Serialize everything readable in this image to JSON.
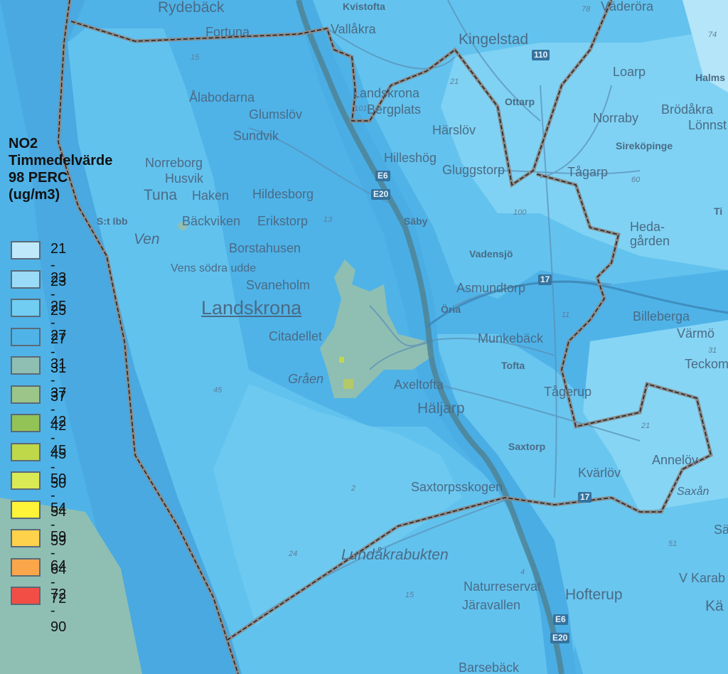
{
  "legend": {
    "title": [
      "NO2",
      "Timmedelvärde",
      "98 PERC",
      "(ug/m3)"
    ],
    "items": [
      {
        "label": "21 - 23",
        "color": "#bfe9fb"
      },
      {
        "label": "23 - 25",
        "color": "#9adcf7"
      },
      {
        "label": "25 - 27",
        "color": "#71cdf2"
      },
      {
        "label": "27 - 31",
        "color": "#4fb3e8"
      },
      {
        "label": "31 - 37",
        "color": "#8fbfb3"
      },
      {
        "label": "37 - 42",
        "color": "#9cc58a"
      },
      {
        "label": "42 - 45",
        "color": "#93c356"
      },
      {
        "label": "45 - 50",
        "color": "#bfd84a"
      },
      {
        "label": "50 - 54",
        "color": "#d9ea55"
      },
      {
        "label": "54 - 59",
        "color": "#fff438"
      },
      {
        "label": "59 - 64",
        "color": "#ffd24b"
      },
      {
        "label": "64 - 72",
        "color": "#fba64a"
      },
      {
        "label": "72 - 90",
        "color": "#f24e45"
      }
    ]
  },
  "places": {
    "rydeback": "Rydebäck",
    "kvistofta": "Kvistofta",
    "fortuna": "Fortuna",
    "vallakra": "Vallåkra",
    "kingelstad": "Kingelstad",
    "vaderora": "Väderöra",
    "loarp": "Loarp",
    "halms": "Halms",
    "alabodarna": "Ålabodarna",
    "glumslov": "Glumslöv",
    "landskrona_bergplats": "Landskrona",
    "bergplats": "Bergplats",
    "ottarp": "Ottarp",
    "norraby": "Norraby",
    "brodakra": "Brödåkra",
    "lonnst": "Lönnst",
    "sundvik": "Sundvik",
    "harslov": "Härslöv",
    "sirekopinge": "Sireköpinge",
    "norreborg": "Norreborg",
    "husvik": "Husvik",
    "tuna": "Tuna",
    "haken": "Haken",
    "hildesborg": "Hildesborg",
    "hilleshog": "Hilleshög",
    "gluggstorp": "Gluggstorp",
    "tagarp": "Tågarp",
    "stibb": "S:t Ibb",
    "backviken": "Bäckviken",
    "erikstorp": "Erikstorp",
    "saby": "Säby",
    "hedagarden": "Heda-",
    "hedagarden2": "gården",
    "ven": "Ven",
    "borstahusen": "Borstahusen",
    "vadensjo": "Vadensjö",
    "vens_sodra": "Vens södra udde",
    "svaneholm": "Svaneholm",
    "asmundtorp": "Asmundtorp",
    "landskrona": "Landskrona",
    "oria": "Öria",
    "billeberga": "Billeberga",
    "varmo": "Värmö",
    "citadellet": "Citadellet",
    "munkeback": "Munkebäck",
    "tofta": "Tofta",
    "teckom": "Teckom",
    "graen": "Gråen",
    "axeltofta": "Axeltofta",
    "tagerup": "Tågerup",
    "haljarp": "Häljarp",
    "saxtorp": "Saxtorp",
    "annelov": "Annelöv",
    "kvarlov": "Kvärlöv",
    "saxtorpsskogen": "Saxtorpsskogen",
    "saxan": "Saxån",
    "lundakrabukten": "Lundåkrabukten",
    "vkarab": "V Karab",
    "ka": "Kä",
    "naturreservat": "Naturreservat",
    "jaravallen": "Järavallen",
    "hofterup": "Hofterup",
    "barseback": "Barsebäck",
    "ti": "Ti",
    "sa": "Sä"
  },
  "numbers": {
    "n15a": "15",
    "n78": "78",
    "n74": "74",
    "n21a": "21",
    "n101": "101",
    "n60": "60",
    "n13": "13",
    "n100": "100",
    "n11": "11",
    "n31": "31",
    "n45": "45",
    "n21b": "21",
    "n2": "2",
    "n51": "51",
    "n24": "24",
    "n4": "4",
    "n15b": "15"
  },
  "shields": {
    "e6_top": "E6",
    "e20_top": "E20",
    "r110": "110",
    "r17": "17",
    "e6_bot": "E6",
    "e20_bot": "E20",
    "r17b": "17"
  }
}
